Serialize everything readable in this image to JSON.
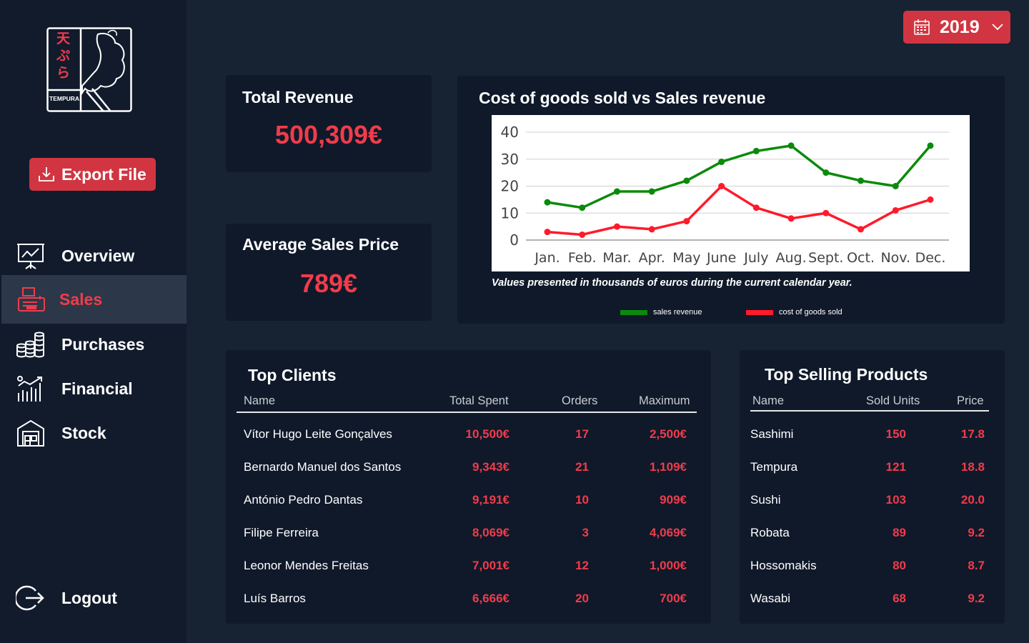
{
  "app": {
    "logo_text": "TEMPURA",
    "logo_kanji": "天ぷら"
  },
  "sidebar": {
    "export_label": "Export File",
    "items": [
      {
        "label": "Overview",
        "icon": "presentation-chart-icon"
      },
      {
        "label": "Sales",
        "icon": "cash-register-icon",
        "active": true
      },
      {
        "label": "Purchases",
        "icon": "coin-stacks-icon"
      },
      {
        "label": "Financial",
        "icon": "bar-chart-growth-icon"
      },
      {
        "label": "Stock",
        "icon": "warehouse-icon"
      }
    ],
    "logout_label": "Logout"
  },
  "header": {
    "year": "2019"
  },
  "kpis": {
    "total_revenue": {
      "title": "Total Revenue",
      "value": "500,309€"
    },
    "average_price": {
      "title": "Average Sales Price",
      "value": "789€"
    }
  },
  "chart_card": {
    "title": "Cost of goods sold vs Sales revenue",
    "note": "Values presented in thousands of euros during the current calendar year."
  },
  "chart_data": {
    "type": "line",
    "title": "Cost of goods sold vs Sales revenue",
    "categories": [
      "Jan.",
      "Feb.",
      "Mar.",
      "Apr.",
      "May",
      "June",
      "July",
      "Aug.",
      "Sept.",
      "Oct.",
      "Nov.",
      "Dec."
    ],
    "ylim": [
      0,
      40
    ],
    "yticks": [
      0,
      10,
      20,
      30,
      40
    ],
    "grid": true,
    "legend_position": "bottom",
    "series": [
      {
        "name": "sales revenue",
        "color": "#0a8a0a",
        "values": [
          14,
          12,
          18,
          18,
          22,
          29,
          33,
          35,
          25,
          22,
          20,
          35
        ]
      },
      {
        "name": "cost of goods sold",
        "color": "#ff1a2a",
        "values": [
          3,
          2,
          5,
          4,
          7,
          20,
          12,
          8,
          10,
          4,
          11,
          15
        ]
      }
    ]
  },
  "top_clients": {
    "title": "Top Clients",
    "headers": [
      "Name",
      "Total Spent",
      "Orders",
      "Maximum"
    ],
    "rows": [
      [
        "Vítor Hugo Leite Gonçalves",
        "10,500€",
        "17",
        "2,500€"
      ],
      [
        "Bernardo Manuel dos Santos",
        "9,343€",
        "21",
        "1,109€"
      ],
      [
        "António Pedro Dantas",
        "9,191€",
        "10",
        "909€"
      ],
      [
        "Filipe Ferreira",
        "8,069€",
        "3",
        "4,069€"
      ],
      [
        "Leonor Mendes Freitas",
        "7,001€",
        "12",
        "1,000€"
      ],
      [
        "Luís Barros",
        "6,666€",
        "20",
        "700€"
      ]
    ]
  },
  "top_products": {
    "title": "Top Selling Products",
    "headers": [
      "Name",
      "Sold Units",
      "Price"
    ],
    "rows": [
      [
        "Sashimi",
        "150",
        "17.8"
      ],
      [
        "Tempura",
        "121",
        "18.8"
      ],
      [
        "Sushi",
        "103",
        "20.0"
      ],
      [
        "Robata",
        "89",
        "9.2"
      ],
      [
        "Hossomakis",
        "80",
        "8.7"
      ],
      [
        "Wasabi",
        "68",
        "9.2"
      ]
    ]
  },
  "colors": {
    "background": "#172233",
    "sidebar": "#111b2c",
    "card": "#0f192a",
    "accent": "#d13541",
    "value_red": "#f03c4b"
  }
}
